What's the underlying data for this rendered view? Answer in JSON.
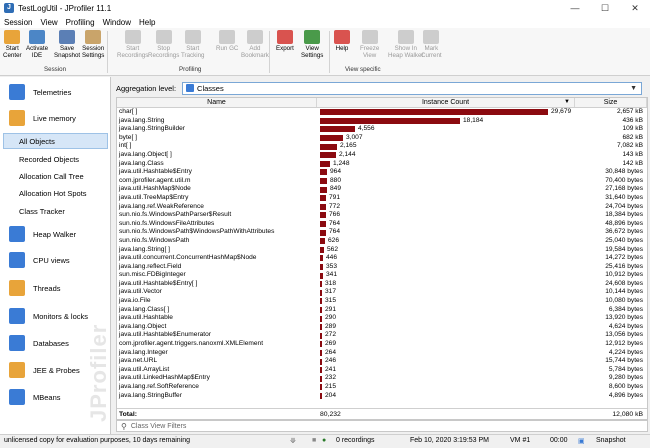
{
  "window": {
    "title": "TestLogUtil - JProfiler 11.1",
    "app_icon": "J"
  },
  "menu": [
    "Session",
    "View",
    "Profiling",
    "Window",
    "Help"
  ],
  "toolbar": {
    "buttons": [
      {
        "label1": "Start",
        "label2": "Center",
        "icon": "folder-star-icon",
        "color": "#e8a43a"
      },
      {
        "label1": "Activate",
        "label2": "IDE",
        "icon": "activate-ide-icon",
        "color": "#4c86c6"
      },
      {
        "label1": "Save",
        "label2": "Snapshot",
        "icon": "save-icon",
        "color": "#5b7fb5"
      },
      {
        "label1": "Session",
        "label2": "Settings",
        "icon": "session-settings-icon",
        "color": "#c9a46a"
      },
      {
        "label1": "Start",
        "label2": "Recordings",
        "icon": "start-recordings-icon",
        "color": "#999999"
      },
      {
        "label1": "Stop",
        "label2": "Recordings",
        "icon": "stop-recordings-icon",
        "color": "#999999"
      },
      {
        "label1": "Start",
        "label2": "Tracking",
        "icon": "start-tracking-icon",
        "color": "#999999"
      },
      {
        "label1": "Run GC",
        "label2": "",
        "icon": "run-gc-icon",
        "color": "#999999"
      },
      {
        "label1": "Add",
        "label2": "Bookmark",
        "icon": "bookmark-icon",
        "color": "#999999"
      },
      {
        "label1": "Export",
        "label2": "",
        "icon": "export-icon",
        "color": "#d9534f"
      },
      {
        "label1": "View",
        "label2": "Settings",
        "icon": "view-settings-icon",
        "color": "#4a9a4a"
      },
      {
        "label1": "Help",
        "label2": "",
        "icon": "help-icon",
        "color": "#d9534f"
      },
      {
        "label1": "Freeze",
        "label2": "View",
        "icon": "freeze-icon",
        "color": "#999999"
      },
      {
        "label1": "Show In",
        "label2": "Heap Walker",
        "icon": "heap-walker-icon",
        "color": "#999999"
      },
      {
        "label1": "Mark",
        "label2": "Current",
        "icon": "mark-current-icon",
        "color": "#999999"
      }
    ],
    "groups": [
      "Session",
      "Profiling",
      "View specific"
    ]
  },
  "sidebar": {
    "sections": [
      {
        "label": "Telemetries",
        "icon": "telemetries-icon",
        "color": "#3a7bd5"
      },
      {
        "label": "Live memory",
        "icon": "live-memory-icon",
        "color": "#e8a43a"
      },
      {
        "label": "Heap Walker",
        "icon": "heap-walker-icon",
        "color": "#3a7bd5"
      },
      {
        "label": "CPU views",
        "icon": "cpu-views-icon",
        "color": "#3a7bd5"
      },
      {
        "label": "Threads",
        "icon": "threads-icon",
        "color": "#e8a43a"
      },
      {
        "label": "Monitors & locks",
        "icon": "monitors-locks-icon",
        "color": "#3a7bd5"
      },
      {
        "label": "Databases",
        "icon": "databases-icon",
        "color": "#3a7bd5"
      },
      {
        "label": "JEE & Probes",
        "icon": "jee-probes-icon",
        "color": "#e8a43a"
      },
      {
        "label": "MBeans",
        "icon": "mbeans-icon",
        "color": "#3a7bd5"
      }
    ],
    "subitems": [
      "All Objects",
      "Recorded Objects",
      "Allocation Call Tree",
      "Allocation Hot Spots",
      "Class Tracker"
    ],
    "watermark": "JProfiler"
  },
  "aggregation": {
    "label": "Aggregation level:",
    "value": "Classes"
  },
  "table": {
    "headers": {
      "name": "Name",
      "count": "Instance Count",
      "size": "Size"
    },
    "max_count": 29679,
    "rows": [
      {
        "name": "char[ ]",
        "count": 29679,
        "count_text": "29,679",
        "size": "2,657 kB"
      },
      {
        "name": "java.lang.String",
        "count": 18184,
        "count_text": "18,184",
        "size": "436 kB"
      },
      {
        "name": "java.lang.StringBuilder",
        "count": 4556,
        "count_text": "4,556",
        "size": "109 kB"
      },
      {
        "name": "byte[ ]",
        "count": 3007,
        "count_text": "3,007",
        "size": "682 kB"
      },
      {
        "name": "int[ ]",
        "count": 2165,
        "count_text": "2,165",
        "size": "7,082 kB"
      },
      {
        "name": "java.lang.Object[ ]",
        "count": 2144,
        "count_text": "2,144",
        "size": "143 kB"
      },
      {
        "name": "java.lang.Class",
        "count": 1248,
        "count_text": "1,248",
        "size": "142 kB"
      },
      {
        "name": "java.util.Hashtable$Entry",
        "count": 964,
        "count_text": "964",
        "size": "30,848 bytes"
      },
      {
        "name": "com.jprofiler.agent.util.m",
        "count": 880,
        "count_text": "880",
        "size": "70,400 bytes"
      },
      {
        "name": "java.util.HashMap$Node",
        "count": 849,
        "count_text": "849",
        "size": "27,168 bytes"
      },
      {
        "name": "java.util.TreeMap$Entry",
        "count": 791,
        "count_text": "791",
        "size": "31,640 bytes"
      },
      {
        "name": "java.lang.ref.WeakReference",
        "count": 772,
        "count_text": "772",
        "size": "24,704 bytes"
      },
      {
        "name": "sun.nio.fs.WindowsPathParser$Result",
        "count": 766,
        "count_text": "766",
        "size": "18,384 bytes"
      },
      {
        "name": "sun.nio.fs.WindowsFileAttributes",
        "count": 764,
        "count_text": "764",
        "size": "48,896 bytes"
      },
      {
        "name": "sun.nio.fs.WindowsPath$WindowsPathWithAttributes",
        "count": 764,
        "count_text": "764",
        "size": "36,672 bytes"
      },
      {
        "name": "sun.nio.fs.WindowsPath",
        "count": 626,
        "count_text": "626",
        "size": "25,040 bytes"
      },
      {
        "name": "java.lang.String[ ]",
        "count": 562,
        "count_text": "562",
        "size": "19,584 bytes"
      },
      {
        "name": "java.util.concurrent.ConcurrentHashMap$Node",
        "count": 446,
        "count_text": "446",
        "size": "14,272 bytes"
      },
      {
        "name": "java.lang.reflect.Field",
        "count": 353,
        "count_text": "353",
        "size": "25,416 bytes"
      },
      {
        "name": "sun.misc.FDBigInteger",
        "count": 341,
        "count_text": "341",
        "size": "10,912 bytes"
      },
      {
        "name": "java.util.Hashtable$Entry[ ]",
        "count": 318,
        "count_text": "318",
        "size": "24,608 bytes"
      },
      {
        "name": "java.util.Vector",
        "count": 317,
        "count_text": "317",
        "size": "10,144 bytes"
      },
      {
        "name": "java.io.File",
        "count": 315,
        "count_text": "315",
        "size": "10,080 bytes"
      },
      {
        "name": "java.lang.Class[ ]",
        "count": 291,
        "count_text": "291",
        "size": "6,384 bytes"
      },
      {
        "name": "java.util.Hashtable",
        "count": 290,
        "count_text": "290",
        "size": "13,920 bytes"
      },
      {
        "name": "java.lang.Object",
        "count": 289,
        "count_text": "289",
        "size": "4,624 bytes"
      },
      {
        "name": "java.util.Hashtable$Enumerator",
        "count": 272,
        "count_text": "272",
        "size": "13,056 bytes"
      },
      {
        "name": "com.jprofiler.agent.triggers.nanoxml.XMLElement",
        "count": 269,
        "count_text": "269",
        "size": "12,912 bytes"
      },
      {
        "name": "java.lang.Integer",
        "count": 264,
        "count_text": "264",
        "size": "4,224 bytes"
      },
      {
        "name": "java.net.URL",
        "count": 246,
        "count_text": "246",
        "size": "15,744 bytes"
      },
      {
        "name": "java.util.ArrayList",
        "count": 241,
        "count_text": "241",
        "size": "5,784 bytes"
      },
      {
        "name": "java.util.LinkedHashMap$Entry",
        "count": 232,
        "count_text": "232",
        "size": "9,280 bytes"
      },
      {
        "name": "java.lang.ref.SoftReference",
        "count": 215,
        "count_text": "215",
        "size": "8,600 bytes"
      },
      {
        "name": "java.lang.StringBuffer",
        "count": 204,
        "count_text": "204",
        "size": "4,896 bytes"
      }
    ],
    "total": {
      "label": "Total:",
      "count": "80,232",
      "size": "12,080 kB"
    }
  },
  "filter": {
    "placeholder": "Class View Filters"
  },
  "status": {
    "license": "unlicensed copy for evaluation purposes, 10 days remaining",
    "recordings": "0 recordings",
    "datetime": "Feb 10, 2020 3:19:53 PM",
    "vm": "VM #1",
    "elapsed": "00:00",
    "snapshot": "Snapshot"
  }
}
